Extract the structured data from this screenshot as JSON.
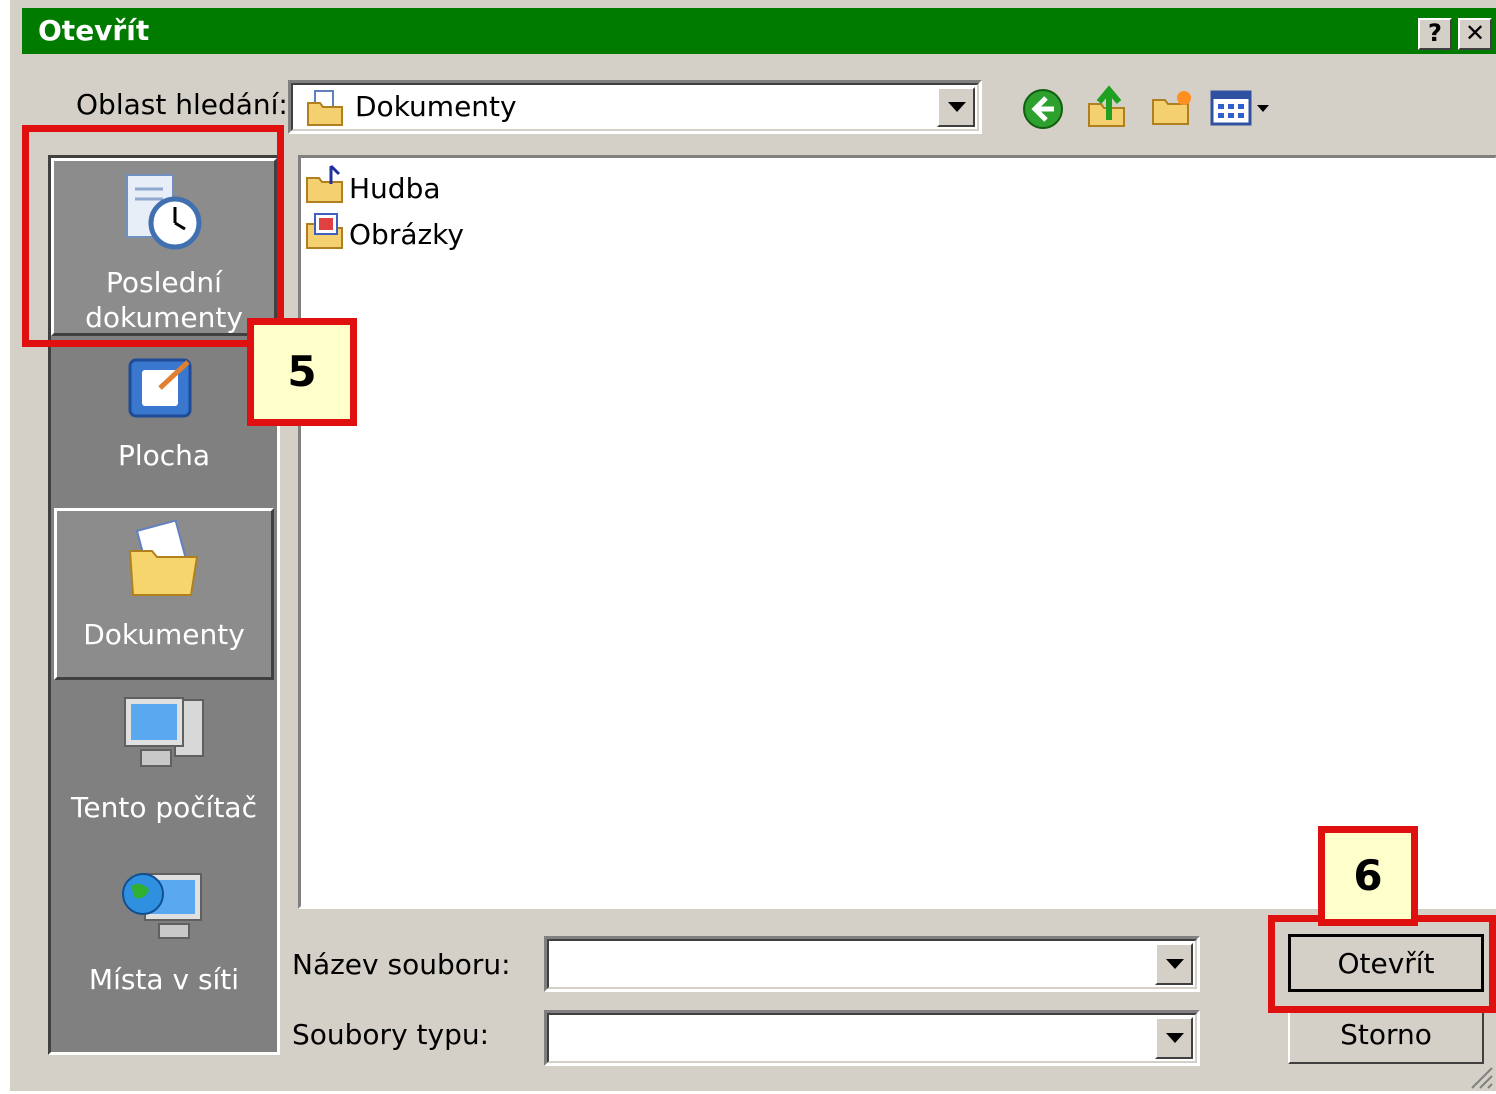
{
  "window": {
    "title": "Otevřít",
    "help_label": "?",
    "close_label": "✕"
  },
  "lookin": {
    "label": "Oblast hledání:",
    "value": "Dokumenty"
  },
  "places": [
    {
      "label": "Poslední dokumenty",
      "icon": "recent-documents-icon",
      "selected": true
    },
    {
      "label": "Plocha",
      "icon": "desktop-icon",
      "selected": false
    },
    {
      "label": "Dokumenty",
      "icon": "my-documents-icon",
      "selected": true
    },
    {
      "label": "Tento počítač",
      "icon": "my-computer-icon",
      "selected": false
    },
    {
      "label": "Místa v síti",
      "icon": "network-places-icon",
      "selected": false
    }
  ],
  "files": [
    {
      "name": "Hudba",
      "icon": "music-folder-icon"
    },
    {
      "name": "Obrázky",
      "icon": "pictures-folder-icon"
    }
  ],
  "filename": {
    "label": "Název souboru:",
    "value": ""
  },
  "filetype": {
    "label": "Soubory typu:",
    "value": ""
  },
  "buttons": {
    "open": "Otevřít",
    "cancel": "Storno"
  },
  "callouts": {
    "step5": "5",
    "step6": "6"
  },
  "colors": {
    "titlebar": "#007b00",
    "highlight": "#e01010",
    "callout_fill": "#ffffcc"
  }
}
